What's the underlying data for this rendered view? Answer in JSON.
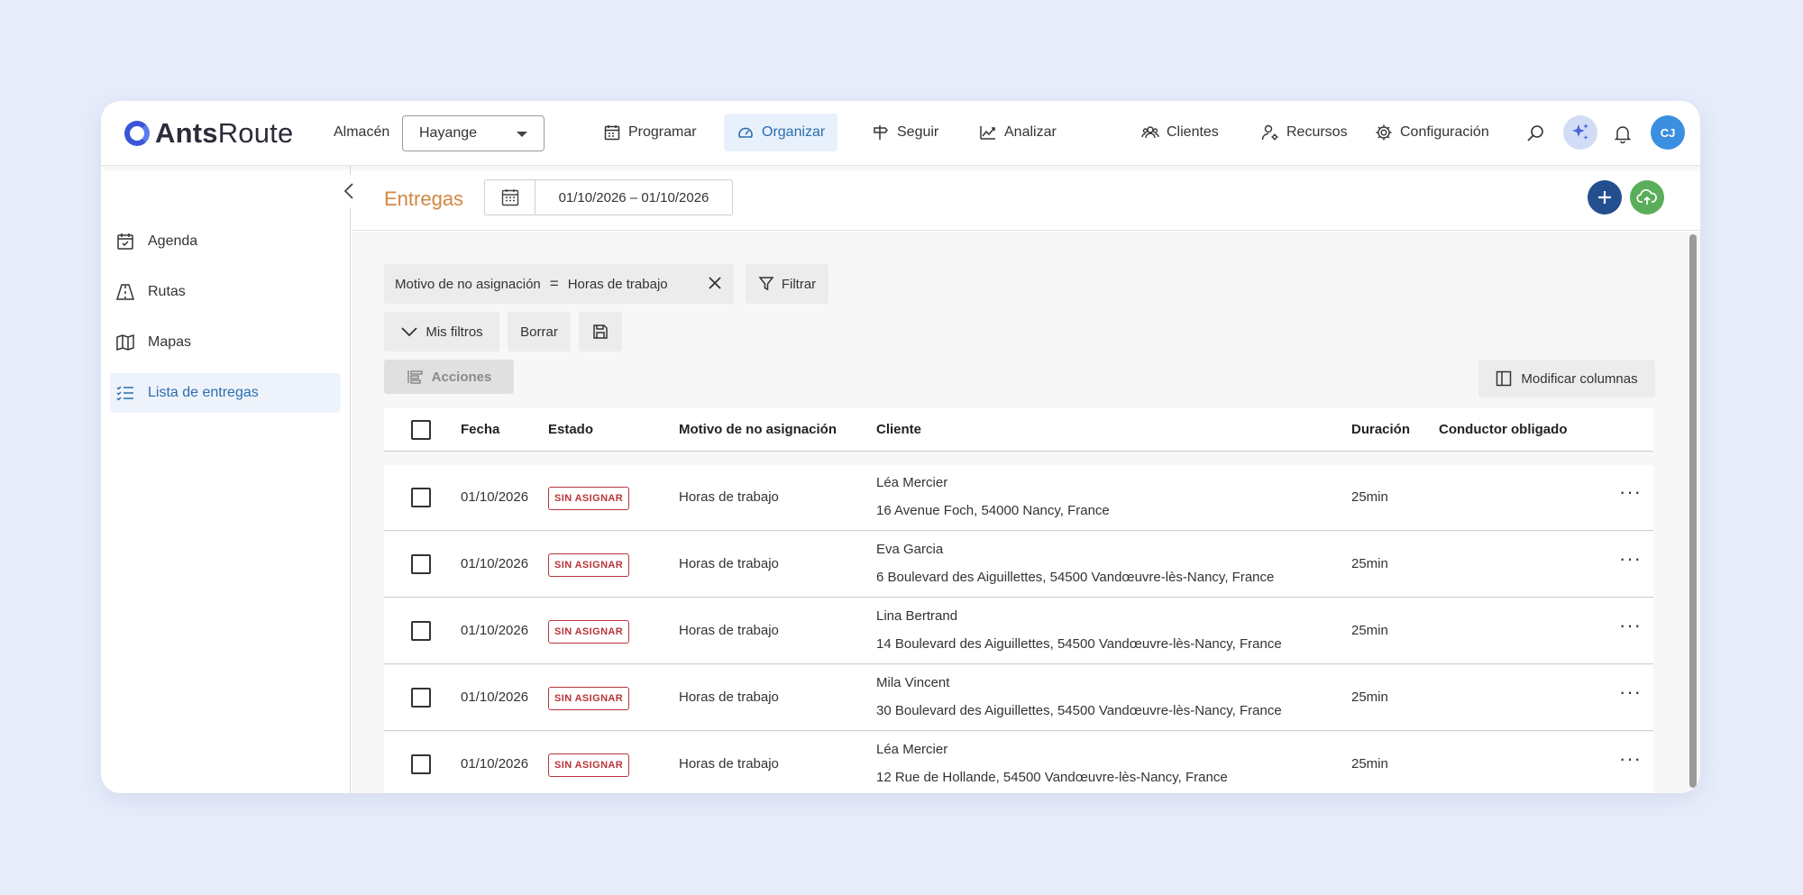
{
  "app": {
    "brand_bold": "Ants",
    "brand_light": "Route"
  },
  "header": {
    "warehouse_label": "Almacén",
    "warehouse_value": "Hayange",
    "nav": [
      {
        "label": "Programar",
        "icon": "calendar-icon",
        "active": false
      },
      {
        "label": "Organizar",
        "icon": "gauge-icon",
        "active": true
      },
      {
        "label": "Seguir",
        "icon": "signpost-icon",
        "active": false
      },
      {
        "label": "Analizar",
        "icon": "chart-icon",
        "active": false
      },
      {
        "label": "Clientes",
        "icon": "people-icon",
        "active": false
      },
      {
        "label": "Recursos",
        "icon": "user-gear-icon",
        "active": false
      },
      {
        "label": "Configuración",
        "icon": "gear-icon",
        "active": false
      }
    ],
    "avatar_initials": "CJ"
  },
  "sidebar": {
    "items": [
      {
        "label": "Agenda",
        "icon": "calendar-check-icon",
        "active": false
      },
      {
        "label": "Rutas",
        "icon": "route-icon",
        "active": false
      },
      {
        "label": "Mapas",
        "icon": "map-icon",
        "active": false
      },
      {
        "label": "Lista de entregas",
        "icon": "list-icon",
        "active": true
      }
    ]
  },
  "page": {
    "title": "Entregas",
    "date_range": "01/10/2026 – 01/10/2026"
  },
  "filters": {
    "field": "Motivo de no asignación",
    "operator": "=",
    "value": "Horas de trabajo",
    "filter_button": "Filtrar",
    "my_filters": "Mis filtros",
    "clear": "Borrar",
    "actions": "Acciones",
    "modify_columns": "Modificar columnas"
  },
  "table": {
    "columns": [
      "Fecha",
      "Estado",
      "Motivo de no asignación",
      "Cliente",
      "Duración",
      "Conductor obligado"
    ],
    "rows": [
      {
        "date": "01/10/2026",
        "status": "SIN ASIGNAR",
        "reason": "Horas de trabajo",
        "client": "Léa Mercier",
        "address": "16 Avenue Foch, 54000 Nancy, France",
        "duration": "25min"
      },
      {
        "date": "01/10/2026",
        "status": "SIN ASIGNAR",
        "reason": "Horas de trabajo",
        "client": "Eva Garcia",
        "address": "6 Boulevard des Aiguillettes, 54500 Vandœuvre-lès-Nancy, France",
        "duration": "25min"
      },
      {
        "date": "01/10/2026",
        "status": "SIN ASIGNAR",
        "reason": "Horas de trabajo",
        "client": "Lina Bertrand",
        "address": "14 Boulevard des Aiguillettes, 54500 Vandœuvre-lès-Nancy, France",
        "duration": "25min"
      },
      {
        "date": "01/10/2026",
        "status": "SIN ASIGNAR",
        "reason": "Horas de trabajo",
        "client": "Mila Vincent",
        "address": "30 Boulevard des Aiguillettes, 54500 Vandœuvre-lès-Nancy, France",
        "duration": "25min"
      },
      {
        "date": "01/10/2026",
        "status": "SIN ASIGNAR",
        "reason": "Horas de trabajo",
        "client": "Léa Mercier",
        "address": "12 Rue de Hollande, 54500 Vandœuvre-lès-Nancy, France",
        "duration": "25min"
      }
    ]
  },
  "colors": {
    "accent": "#2a6db0",
    "title": "#d1873f",
    "status": "#b8343a",
    "add": "#234f8f",
    "upload": "#5aae5a"
  }
}
